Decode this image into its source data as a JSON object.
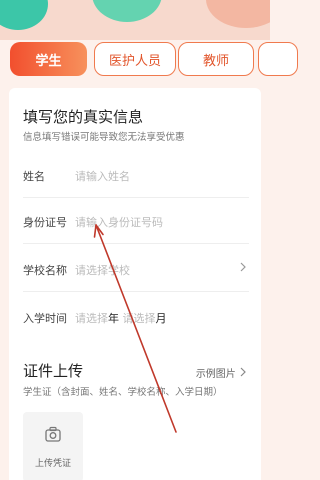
{
  "tabs": [
    {
      "label": "学生",
      "active": true
    },
    {
      "label": "医护人员",
      "active": false
    },
    {
      "label": "教师",
      "active": false
    },
    {
      "label": "",
      "active": false
    }
  ],
  "info_section": {
    "title": "填写您的真实信息",
    "subtitle": "信息填写错误可能导致您无法享受优惠"
  },
  "fields": [
    {
      "label": "姓名",
      "placeholder": "请输入姓名"
    },
    {
      "label": "身份证号",
      "placeholder": "请输入身份证号码"
    },
    {
      "label": "学校名称",
      "placeholder": "请选择学校"
    },
    {
      "label": "入学时间",
      "placeholder_year": "请选择",
      "year_unit": "年",
      "placeholder_month": "请选择",
      "month_unit": "月"
    }
  ],
  "document_section": {
    "title": "证件上传",
    "sample_link": "示例图片",
    "subtitle": "学生证（含封面、姓名、学校名称、入学日期）",
    "upload_label": "上传凭证"
  },
  "colors": {
    "accent": "#f24f2e",
    "accent_light": "#f7915c",
    "arrow": "#c0392b"
  }
}
